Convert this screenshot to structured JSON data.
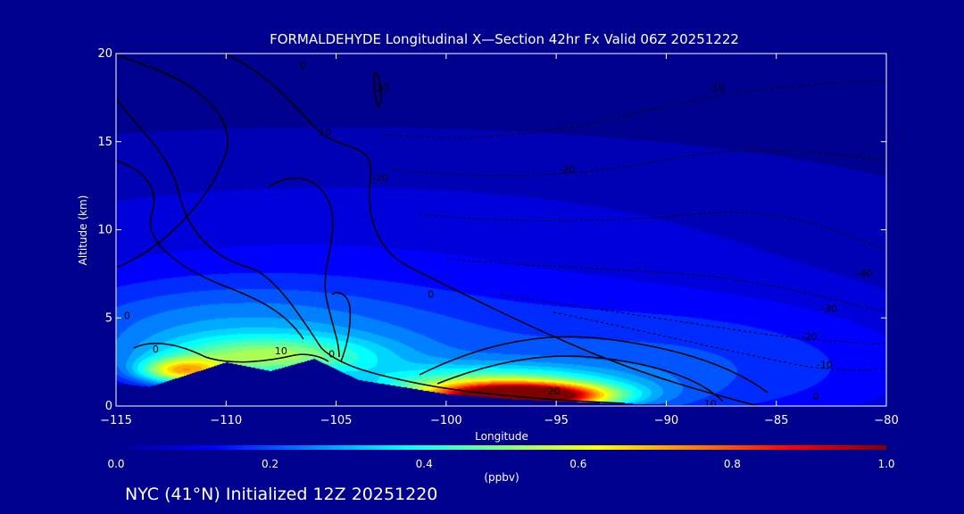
{
  "title": "FORMALDEHYDE Longitudinal X—Section 42hr  Fx Valid 06Z 20251222",
  "footer": "NYC (41°N) Initialized 12Z 20251220",
  "colors": {
    "background": "#00008f",
    "axis": "#ffffff",
    "contour": "#000000"
  },
  "chart_data": {
    "type": "heatmap",
    "title": "FORMALDEHYDE Longitudinal X—Section 42hr  Fx Valid 06Z 20251222",
    "xlabel": "Longitude",
    "ylabel": "Altitude (km)",
    "xlim": [
      -115,
      -80
    ],
    "ylim": [
      0,
      20
    ],
    "x_ticks": [
      -115,
      -110,
      -105,
      -100,
      -95,
      -90,
      -85,
      -80
    ],
    "x_tick_labels": [
      "−115",
      "−110",
      "−105",
      "−100",
      "−95",
      "−90",
      "−85",
      "−80"
    ],
    "y_ticks": [
      0,
      5,
      10,
      15,
      20
    ],
    "colorbar": {
      "unit": "(ppbv)",
      "range": [
        0.0,
        1.0
      ],
      "ticks": [
        0.0,
        0.2,
        0.4,
        0.6,
        0.8,
        1.0
      ],
      "tick_labels": [
        "0.0",
        "0.2",
        "0.4",
        "0.6",
        "0.8",
        "1.0"
      ],
      "colormap": [
        "#00008f",
        "#0000ff",
        "#0080ff",
        "#00ffff",
        "#80ff80",
        "#ffff00",
        "#ff8000",
        "#ff0000",
        "#800000"
      ]
    },
    "terrain": [
      [
        -115,
        1.3
      ],
      [
        -113.5,
        1.1
      ],
      [
        -112,
        1.7
      ],
      [
        -110,
        2.5
      ],
      [
        -108,
        2.0
      ],
      [
        -106,
        2.7
      ],
      [
        -104,
        1.5
      ],
      [
        -102,
        1.1
      ],
      [
        -100,
        0.7
      ],
      [
        -97,
        0.4
      ],
      [
        -93,
        0.2
      ],
      [
        -90,
        0.1
      ],
      [
        -85,
        0.05
      ],
      [
        -80,
        0.0
      ]
    ],
    "field_features": [
      {
        "lon": -96.5,
        "alt": 0.6,
        "sigma_lon": 2.5,
        "sigma_alt": 0.45,
        "value": 0.85
      },
      {
        "lon": -98.0,
        "alt": 0.9,
        "sigma_lon": 4.0,
        "sigma_alt": 0.9,
        "value": 0.45
      },
      {
        "lon": -112.0,
        "alt": 2.0,
        "sigma_lon": 1.4,
        "sigma_alt": 0.5,
        "value": 0.45
      },
      {
        "lon": -108.0,
        "alt": 2.8,
        "sigma_lon": 3.5,
        "sigma_alt": 0.8,
        "value": 0.3
      },
      {
        "lon": -110.0,
        "alt": 4.0,
        "sigma_lon": 7.0,
        "sigma_alt": 2.2,
        "value": 0.22
      },
      {
        "lon": -90.0,
        "alt": 2.0,
        "sigma_lon": 10.0,
        "sigma_alt": 3.0,
        "value": 0.18
      },
      {
        "lon": -105.0,
        "alt": 9.0,
        "sigma_lon": 18.0,
        "sigma_alt": 4.0,
        "value": 0.09
      }
    ],
    "contour_labels": [
      {
        "text": "20",
        "lon": -95.1,
        "alt": 0.8
      },
      {
        "text": "10",
        "lon": -88.0,
        "alt": 0.1
      },
      {
        "text": "0",
        "lon": -100.7,
        "alt": 6.3
      },
      {
        "text": "0",
        "lon": -83.2,
        "alt": 0.5
      },
      {
        "text": "-10",
        "lon": -82.8,
        "alt": 2.3
      },
      {
        "text": "-20",
        "lon": -83.5,
        "alt": 3.9
      },
      {
        "text": "-30",
        "lon": -82.6,
        "alt": 5.5
      },
      {
        "text": "-40",
        "lon": -81.0,
        "alt": 7.5
      },
      {
        "text": "-10",
        "lon": -87.7,
        "alt": 18.0
      },
      {
        "text": "-20",
        "lon": -94.5,
        "alt": 13.4
      },
      {
        "text": "-20",
        "lon": -103.0,
        "alt": 12.9
      },
      {
        "text": "10",
        "lon": -105.5,
        "alt": 15.5
      },
      {
        "text": "10",
        "lon": -107.5,
        "alt": 3.1
      },
      {
        "text": "0",
        "lon": -114.5,
        "alt": 5.1
      },
      {
        "text": "0",
        "lon": -106.5,
        "alt": 19.3
      },
      {
        "text": "0",
        "lon": -105.2,
        "alt": 2.9
      },
      {
        "text": "0",
        "lon": -113.2,
        "alt": 3.2
      },
      {
        "text": "10",
        "lon": -102.9,
        "alt": 18.0
      }
    ]
  }
}
